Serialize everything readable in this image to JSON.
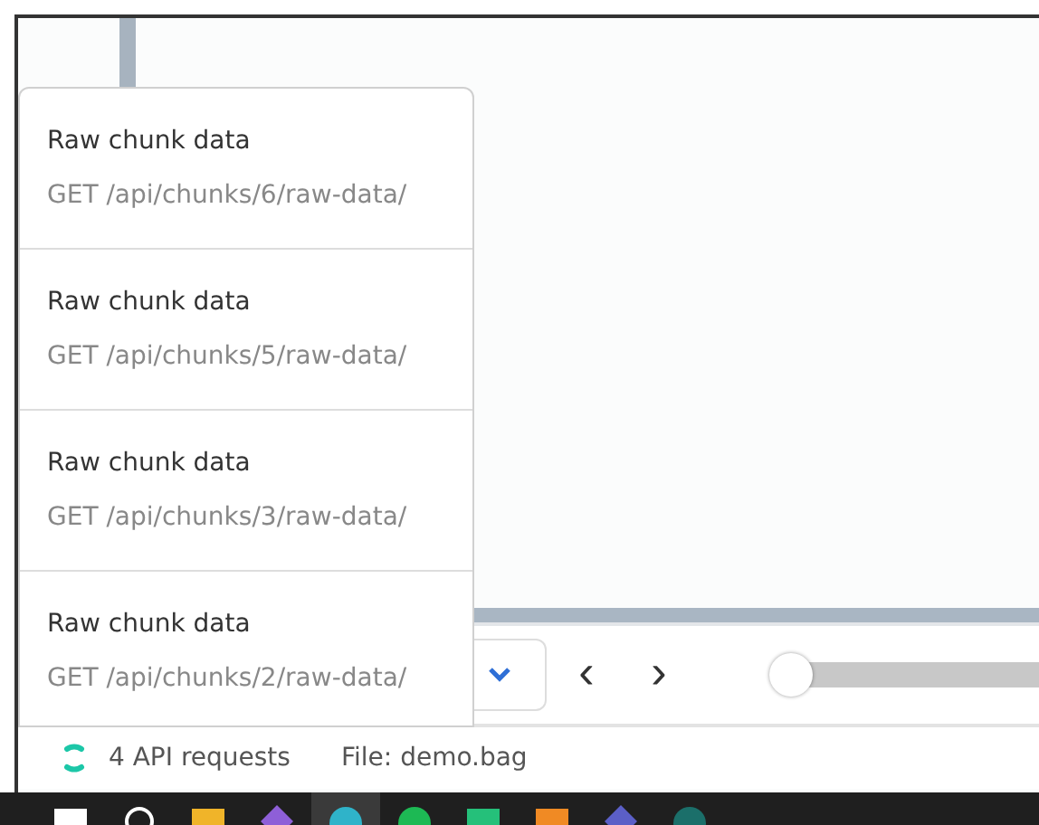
{
  "requests_popup": {
    "items": [
      {
        "title": "Raw chunk data",
        "endpoint": "GET /api/chunks/6/raw-data/"
      },
      {
        "title": "Raw chunk data",
        "endpoint": "GET /api/chunks/5/raw-data/"
      },
      {
        "title": "Raw chunk data",
        "endpoint": "GET /api/chunks/3/raw-data/"
      },
      {
        "title": "Raw chunk data",
        "endpoint": "GET /api/chunks/2/raw-data/"
      }
    ]
  },
  "playback": {
    "prev": "‹",
    "next": "›",
    "slider": {
      "level": 0
    }
  },
  "status_bar": {
    "requests": "4 API requests",
    "file": "File: demo.bag"
  }
}
